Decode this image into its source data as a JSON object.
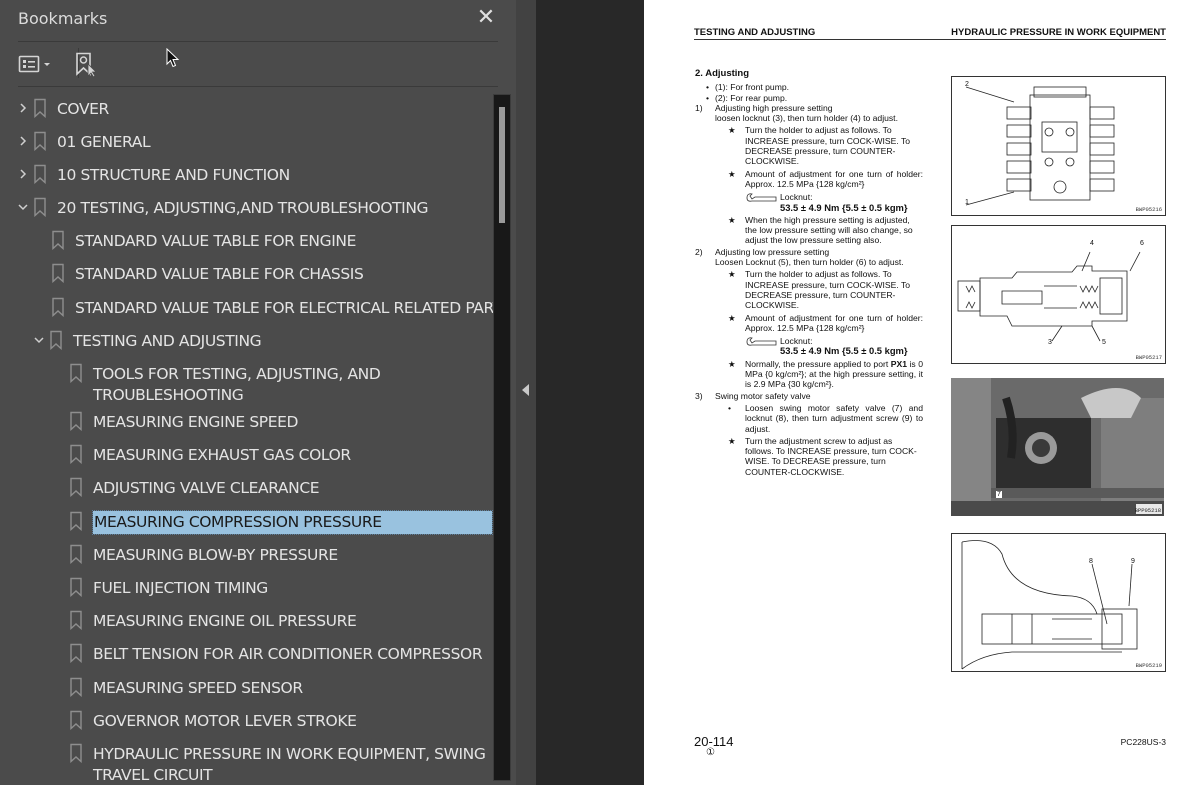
{
  "panel": {
    "title": "Bookmarks",
    "close_icon": "close-icon",
    "toolbar": {
      "options_icon": "list-options-icon",
      "find_bookmark_icon": "find-bookmark-icon"
    }
  },
  "bookmarks": [
    {
      "label": "COVER",
      "level": 0,
      "expander": "collapsed"
    },
    {
      "label": "01 GENERAL",
      "level": 0,
      "expander": "collapsed"
    },
    {
      "label": "10 STRUCTURE AND FUNCTION",
      "level": 0,
      "expander": "collapsed"
    },
    {
      "label": "20 TESTING, ADJUSTING,AND TROUBLESHOOTING",
      "level": 0,
      "expander": "expanded"
    },
    {
      "label": "STANDARD VALUE TABLE FOR ENGINE",
      "level": 1,
      "expander": "none"
    },
    {
      "label": "STANDARD VALUE TABLE FOR CHASSIS",
      "level": 1,
      "expander": "none"
    },
    {
      "label": "STANDARD VALUE TABLE FOR ELECTRICAL RELATED PARTS",
      "level": 1,
      "expander": "none"
    },
    {
      "label": "TESTING AND ADJUSTING",
      "level": 1,
      "expander": "expanded"
    },
    {
      "label": "TOOLS FOR TESTING, ADJUSTING, AND TROUBLESHOOTING",
      "level": 2,
      "expander": "none"
    },
    {
      "label": "MEASURING ENGINE SPEED",
      "level": 2,
      "expander": "none"
    },
    {
      "label": "MEASURING EXHAUST GAS COLOR",
      "level": 2,
      "expander": "none"
    },
    {
      "label": "ADJUSTING VALVE CLEARANCE",
      "level": 2,
      "expander": "none"
    },
    {
      "label": "MEASURING COMPRESSION PRESSURE",
      "level": 2,
      "expander": "none",
      "selected": true
    },
    {
      "label": "MEASURING BLOW-BY PRESSURE",
      "level": 2,
      "expander": "none"
    },
    {
      "label": "FUEL INJECTION TIMING",
      "level": 2,
      "expander": "none"
    },
    {
      "label": "MEASURING ENGINE OIL PRESSURE",
      "level": 2,
      "expander": "none"
    },
    {
      "label": "BELT TENSION FOR AIR CONDITIONER COMPRESSOR",
      "level": 2,
      "expander": "none"
    },
    {
      "label": "MEASURING SPEED SENSOR",
      "level": 2,
      "expander": "none"
    },
    {
      "label": "GOVERNOR MOTOR LEVER STROKE",
      "level": 2,
      "expander": "none"
    },
    {
      "label": "HYDRAULIC PRESSURE IN WORK EQUIPMENT, SWING TRAVEL CIRCUIT",
      "level": 2,
      "expander": "none"
    }
  ],
  "colors": {
    "panel_bg": "#4b4b4b",
    "selection": "#99c2df",
    "viewer_bg": "#282828"
  },
  "document": {
    "header_left": "TESTING AND ADJUSTING",
    "header_right": "HYDRAULIC PRESSURE IN WORK EQUIPMENT",
    "section_title": "2.  Adjusting",
    "bullets": [
      "(1): For front pump.",
      "(2): For rear pump."
    ],
    "step1": {
      "num": "1)",
      "title": "Adjusting high pressure setting",
      "body": "loosen locknut (3), then turn holder (4) to adjust.",
      "notes": [
        "Turn the holder to adjust as follows. To INCREASE pressure, turn COCK-WISE. To DECREASE pressure, turn COUNTER-CLOCKWISE.",
        "Amount of adjustment for one turn of holder: Approx. 12.5 MPa {128 kg/cm²}"
      ],
      "torque_label": "Locknut:",
      "torque_value": "53.5 ± 4.9 Nm {5.5 ± 0.5 kgm}",
      "note3": "When the high pressure setting is adjusted, the low pressure setting will also change, so adjust the low pressure setting also."
    },
    "step2": {
      "num": "2)",
      "title": "Adjusting low pressure setting",
      "body": "Loosen Locknut (5), then turn holder (6) to adjust.",
      "notes": [
        "Turn the holder to adjust as follows. To INCREASE pressure, turn COCK-WISE. To DECREASE pressure, turn COUNTER-CLOCKWISE.",
        "Amount of adjustment for one turn of holder: Approx. 12.5 MPa {128 kg/cm²}"
      ],
      "torque_label": "Locknut:",
      "torque_value": "53.5 ± 4.9 Nm {5.5 ± 0.5 kgm}",
      "note3_pre": "Normally, the pressure applied to port ",
      "note3_bold": "PX1",
      "note3_post": " is 0 MPa {0 kg/cm²}; at the high pressure setting, it is 2.9 MPa {30 kg/cm²}."
    },
    "step3": {
      "num": "3)",
      "title": "Swing motor safety valve",
      "bullet": "Loosen swing motor safety valve (7) and locknut (8), then turn adjustment screw (9) to adjust.",
      "note": "Turn the adjustment screw to adjust as follows. To INCREASE pressure, turn COCK-WISE. To DECREASE pressure, turn COUNTER-CLOCKWISE."
    },
    "figures": [
      {
        "code": "BWP05216",
        "callouts": [
          "2",
          "1"
        ]
      },
      {
        "code": "BWP05217",
        "callouts": [
          "4",
          "6",
          "3",
          "5"
        ]
      },
      {
        "code": "BPP05218",
        "callouts": [
          "7"
        ]
      },
      {
        "code": "BWP05219",
        "callouts": [
          "8",
          "9"
        ]
      }
    ],
    "footer_page": "20-114",
    "footer_rev": "①",
    "footer_model": "PC228US-3"
  }
}
